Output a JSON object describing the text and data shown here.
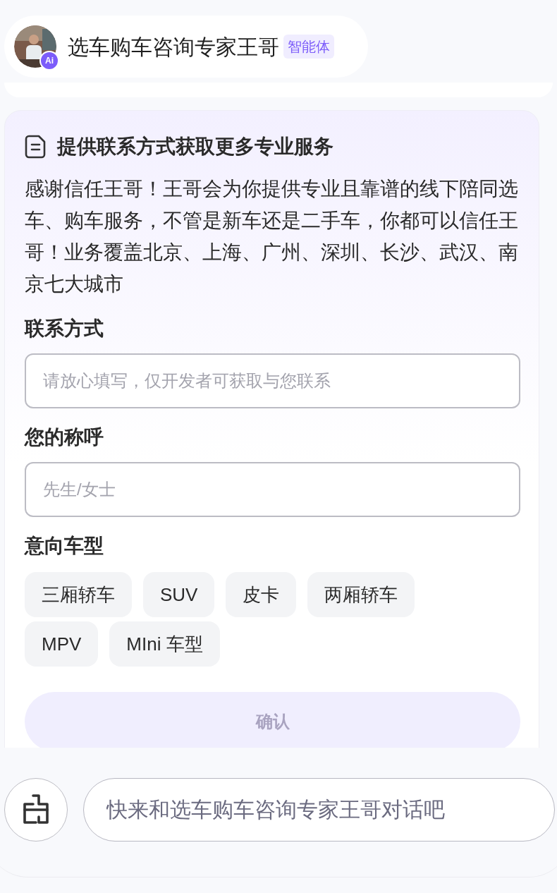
{
  "header": {
    "title": "选车购车咨询专家王哥",
    "badge": "智能体",
    "avatar_badge": "Ai"
  },
  "form": {
    "title": "提供联系方式获取更多专业服务",
    "intro": "感谢信任王哥！王哥会为你提供专业且靠谱的线下陪同选车、购车服务，不管是新车还是二手车，你都可以信任王哥！业务覆盖北京、上海、广州、深圳、长沙、武汉、南京七大城市",
    "fields": [
      {
        "label": "联系方式",
        "placeholder": "请放心填写，仅开发者可获取与您联系"
      },
      {
        "label": "您的称呼",
        "placeholder": "先生/女士"
      }
    ],
    "car_types": {
      "label": "意向车型",
      "options": [
        {
          "label": "三厢轿车",
          "selected": false
        },
        {
          "label": "SUV",
          "selected": false
        },
        {
          "label": "皮卡",
          "selected": false
        },
        {
          "label": "两厢轿车",
          "selected": false
        },
        {
          "label": "MPV",
          "selected": false
        },
        {
          "label": "MIni 车型",
          "selected": false
        }
      ]
    },
    "submit": "确认"
  },
  "composer": {
    "placeholder": "快来和选车购车咨询专家王哥对话吧"
  }
}
